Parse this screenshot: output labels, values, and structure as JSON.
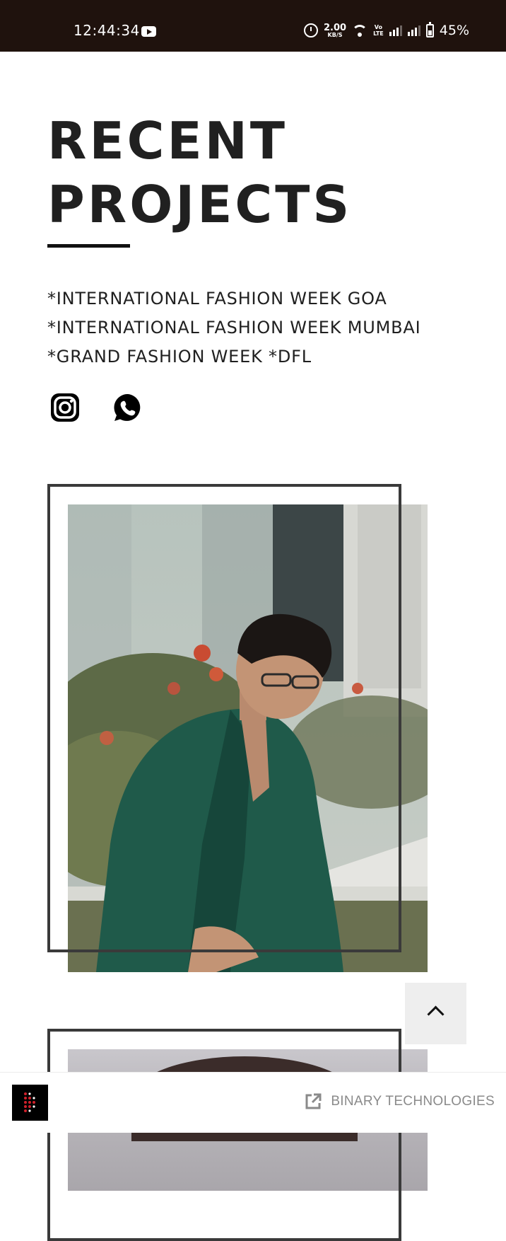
{
  "status_bar": {
    "time": "12:44:34",
    "network_speed": "2.00",
    "network_speed_unit": "KB/S",
    "volte_label": "Vo\nLTE",
    "battery": "45%"
  },
  "header": {
    "title_line1": "RECENT",
    "title_line2": "PROJECTS"
  },
  "projects": [
    "*INTERNATIONAL FASHION WEEK GOA",
    "*INTERNATIONAL FASHION WEEK MUMBAI",
    "*GRAND FASHION WEEK *DFL"
  ],
  "social": {
    "instagram_icon": "instagram-icon",
    "whatsapp_icon": "whatsapp-icon"
  },
  "bottom_bar": {
    "brand_text": "BINARY TECHNOLOGIES",
    "link_icon": "external-link-icon"
  },
  "colors": {
    "status_bar_bg": "#1f120d",
    "text_dark": "#202020",
    "frame": "#3a3a3a",
    "scroll_button_bg": "#eeeeee",
    "bottom_text": "#8a8a8a",
    "brand_red": "#d0202a"
  }
}
